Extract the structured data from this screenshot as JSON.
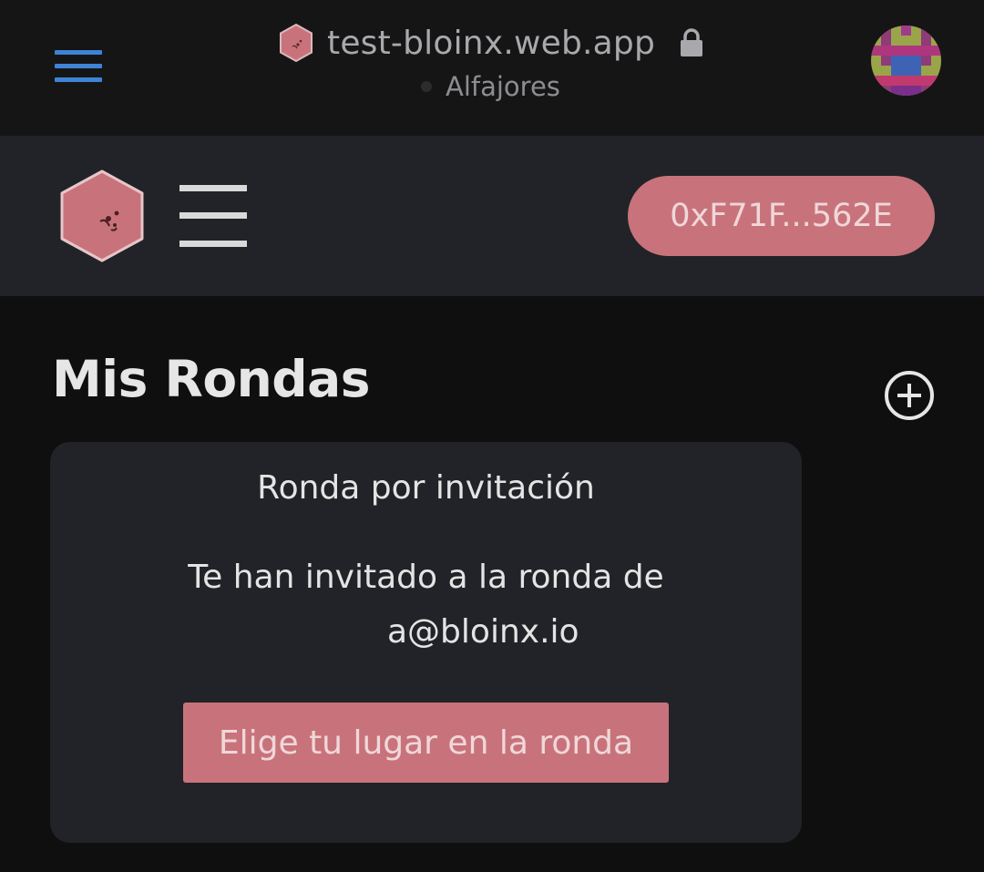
{
  "browser": {
    "site_url": "test-bloinx.web.app",
    "network_name": "Alfajores",
    "icons": {
      "menu": "hamburger-menu-icon",
      "favicon": "bloinx-favicon-icon",
      "lock": "lock-icon",
      "network_status": "status-dot-icon",
      "account": "identicon-avatar"
    }
  },
  "app_header": {
    "wallet_address": "0xF71F...562E",
    "icons": {
      "logo": "bloinx-logo-icon",
      "menu": "hamburger-menu-icon"
    }
  },
  "main": {
    "title": "Mis Rondas",
    "add_icon": "plus-circle-icon",
    "invitation_card": {
      "title": "Ronda por invitación",
      "message": "Te han invitado a la ronda de",
      "inviter_email": "a@bloinx.io",
      "button_label": "Elige tu lugar en la ronda"
    }
  },
  "colors": {
    "page_background": "#0f0f10",
    "browser_bar": "#151516",
    "header_background": "#222328",
    "card_background": "#222328",
    "accent": "#c8737b",
    "menu_blue": "#3e84d6",
    "text_light": "#e4e4e4"
  }
}
